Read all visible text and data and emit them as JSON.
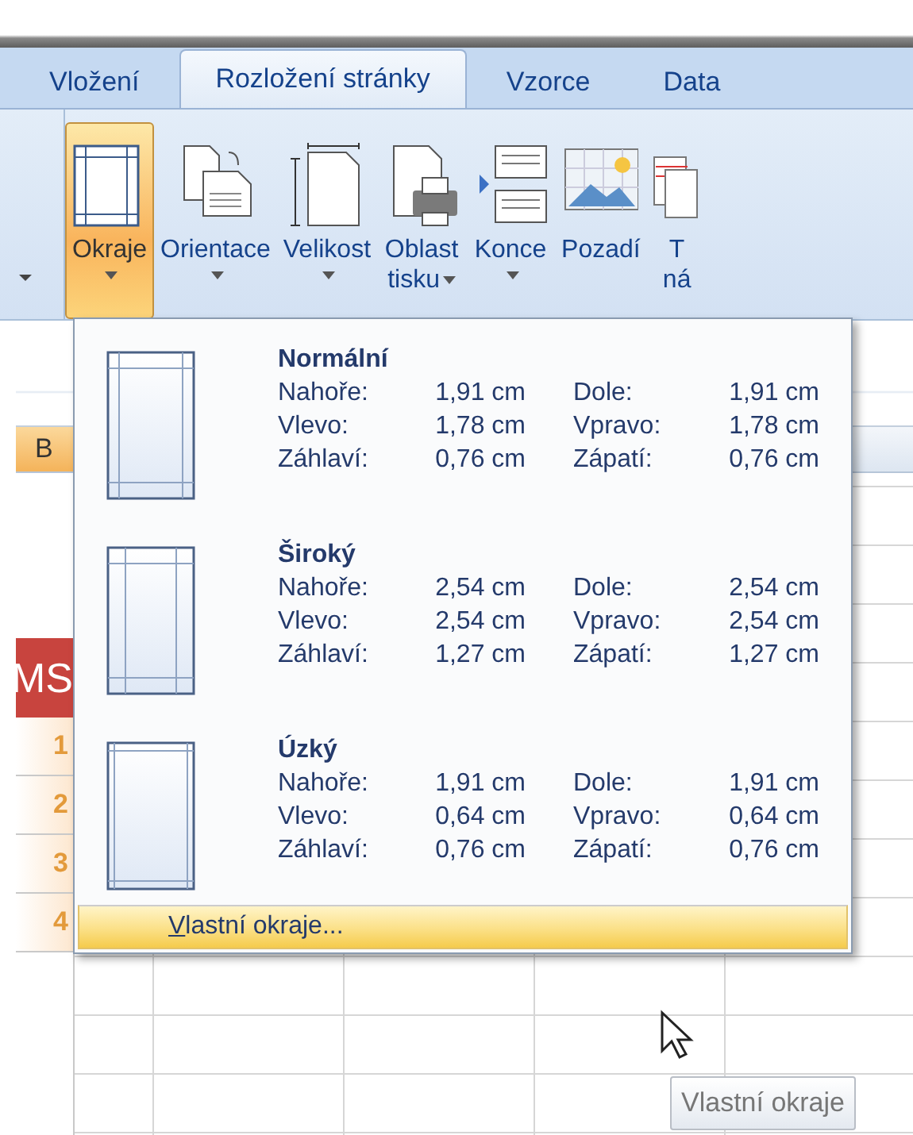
{
  "tabs": [
    {
      "label": "Vložení",
      "selected": false
    },
    {
      "label": "Rozložení stránky",
      "selected": true
    },
    {
      "label": "Vzorce",
      "selected": false
    },
    {
      "label": "Data",
      "selected": false
    }
  ],
  "ribbon": {
    "buttons": [
      {
        "kind": "margins",
        "lines": [
          "Okraje"
        ],
        "has_menu": true,
        "selected": true
      },
      {
        "kind": "orientation",
        "lines": [
          "Orientace"
        ],
        "has_menu": true,
        "selected": false
      },
      {
        "kind": "size",
        "lines": [
          "Velikost"
        ],
        "has_menu": true,
        "selected": false
      },
      {
        "kind": "print_area",
        "lines": [
          "Oblast",
          "tisku"
        ],
        "has_menu": true,
        "selected": false
      },
      {
        "kind": "breaks",
        "lines": [
          "Konce"
        ],
        "has_menu": true,
        "selected": false
      },
      {
        "kind": "background",
        "lines": [
          "Pozadí"
        ],
        "has_menu": false,
        "selected": false
      },
      {
        "kind": "titles",
        "lines": [
          "T",
          "ná"
        ],
        "has_menu": false,
        "selected": false
      }
    ]
  },
  "sheet": {
    "column_header": "B",
    "cell": "MS",
    "row_numbers": [
      "1",
      "2",
      "3",
      "4"
    ]
  },
  "margins_menu": {
    "items": [
      {
        "kind": "normal",
        "title": "Normální",
        "fields": [
          {
            "label": "Nahoře:",
            "value": "1,91 cm"
          },
          {
            "label": "Dole:",
            "value": "1,91 cm"
          },
          {
            "label": "Vlevo:",
            "value": "1,78 cm"
          },
          {
            "label": "Vpravo:",
            "value": "1,78 cm"
          },
          {
            "label": "Záhlaví:",
            "value": "0,76 cm"
          },
          {
            "label": "Zápatí:",
            "value": "0,76 cm"
          }
        ]
      },
      {
        "kind": "wide",
        "title": "Široký",
        "fields": [
          {
            "label": "Nahoře:",
            "value": "2,54 cm"
          },
          {
            "label": "Dole:",
            "value": "2,54 cm"
          },
          {
            "label": "Vlevo:",
            "value": "2,54 cm"
          },
          {
            "label": "Vpravo:",
            "value": "2,54 cm"
          },
          {
            "label": "Záhlaví:",
            "value": "1,27 cm"
          },
          {
            "label": "Zápatí:",
            "value": "1,27 cm"
          }
        ]
      },
      {
        "kind": "narrow",
        "title": "Úzký",
        "fields": [
          {
            "label": "Nahoře:",
            "value": "1,91 cm"
          },
          {
            "label": "Dole:",
            "value": "1,91 cm"
          },
          {
            "label": "Vlevo:",
            "value": "0,64 cm"
          },
          {
            "label": "Vpravo:",
            "value": "0,64 cm"
          },
          {
            "label": "Záhlaví:",
            "value": "0,76 cm"
          },
          {
            "label": "Zápatí:",
            "value": "0,76 cm"
          }
        ]
      }
    ],
    "custom": {
      "label": "Vlastní okraje...",
      "selected": true
    }
  },
  "tooltip": "Vlastní okraje"
}
